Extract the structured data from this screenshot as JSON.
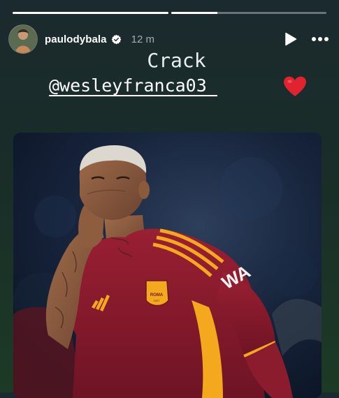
{
  "story": {
    "progress_segments": [
      {
        "progress": 1.0
      },
      {
        "progress": 0.3
      }
    ]
  },
  "header": {
    "username": "paulodybala",
    "time": "12 m",
    "verified_icon": "verified-badge-icon",
    "play_icon": "play-icon",
    "more_icon": "more-dots-icon"
  },
  "content": {
    "caption_line1": "Crack",
    "mention": "@wesleyfranca03_",
    "emoji": "heart-icon"
  },
  "photo": {
    "shirt_sponsor": "WA",
    "crest_text": "ROMA",
    "crest_year": "1927"
  },
  "colors": {
    "shirt": "#8d1b2e",
    "stripe": "#f4a81d",
    "heart": "#e0232e"
  }
}
